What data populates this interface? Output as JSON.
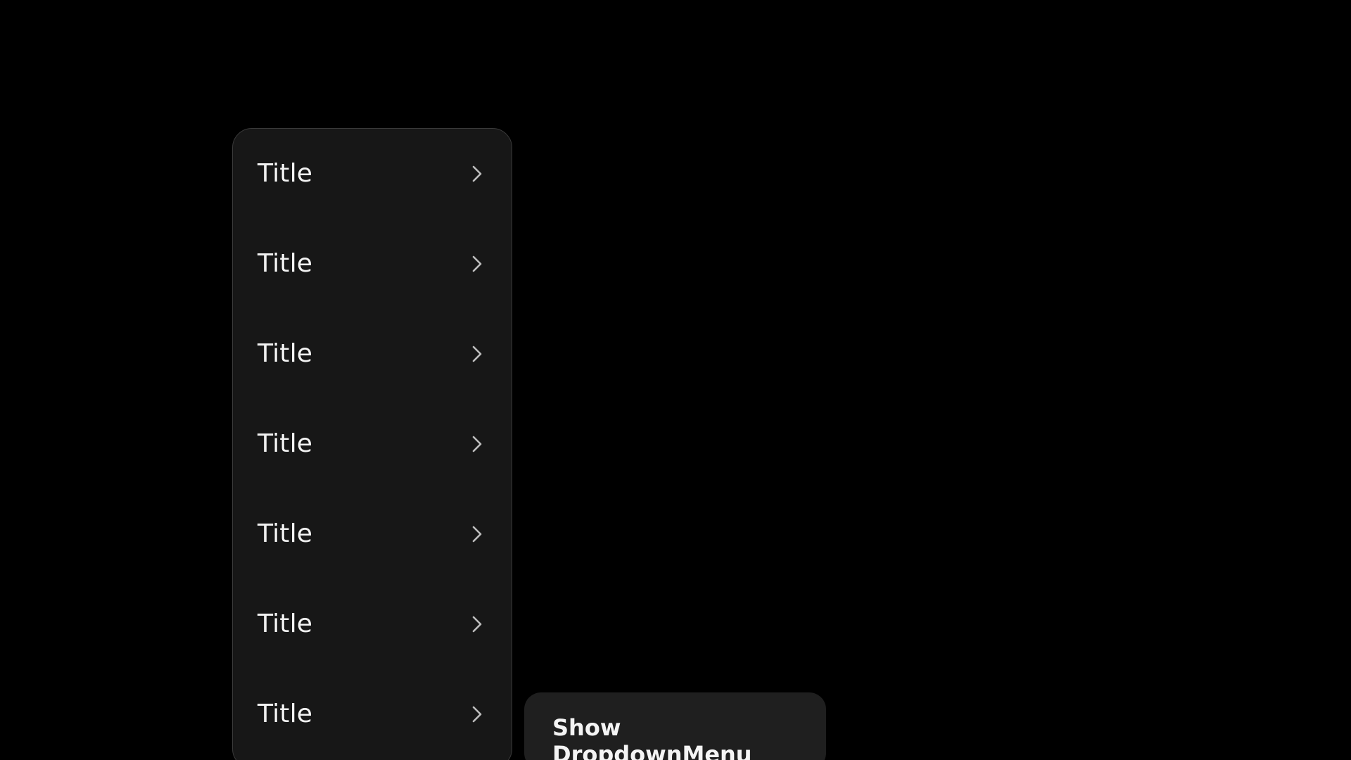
{
  "dropdown_menu": {
    "items": [
      {
        "label": "Title",
        "icon": "chevron-right-icon"
      },
      {
        "label": "Title",
        "icon": "chevron-right-icon"
      },
      {
        "label": "Title",
        "icon": "chevron-right-icon"
      },
      {
        "label": "Title",
        "icon": "chevron-right-icon"
      },
      {
        "label": "Title",
        "icon": "chevron-right-icon"
      },
      {
        "label": "Title",
        "icon": "chevron-right-icon"
      },
      {
        "label": "Title",
        "icon": "chevron-right-icon"
      }
    ]
  },
  "show_button": {
    "label": "Show DropdownMenu"
  },
  "colors": {
    "background": "#000000",
    "menu_surface": "#171717",
    "button_surface": "#1f1f1f",
    "text": "#f2f2f2",
    "chevron": "#bdbdbd"
  }
}
